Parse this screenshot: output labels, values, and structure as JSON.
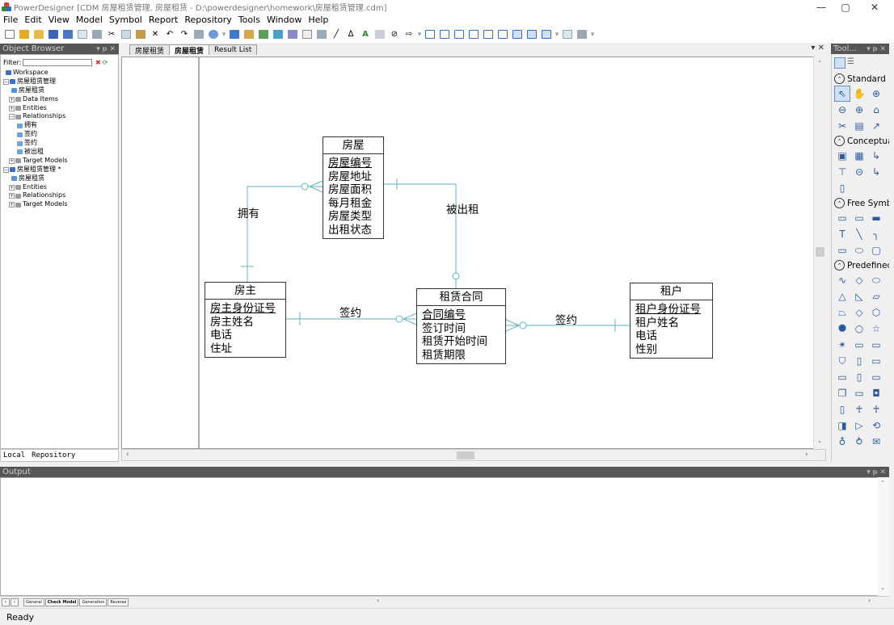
{
  "window": {
    "title": "PowerDesigner [CDM 房屋租赁管理, 房屋租赁 - D:\\powerdesigner\\homework\\房屋租赁管理.cdm]",
    "minimize": "—",
    "restore": "▢",
    "close": "✕"
  },
  "menu": [
    "File",
    "Edit",
    "View",
    "Model",
    "Symbol",
    "Report",
    "Repository",
    "Tools",
    "Window",
    "Help"
  ],
  "object_browser": {
    "title": "Object Browser",
    "controls": "▾ ᵽ ✕",
    "filter_label": "Filter:",
    "filter_value": "",
    "tree": [
      {
        "label": "Workspace",
        "level": 0,
        "expander": "",
        "icon_color": "#3a6fc4"
      },
      {
        "label": "房屋租赁管理",
        "level": 0,
        "expander": "−",
        "icon_color": "#3a6fc4"
      },
      {
        "label": "房屋租赁",
        "level": 1,
        "expander": "",
        "icon_color": "#5b8fd8"
      },
      {
        "label": "Data Items",
        "level": 1,
        "expander": "+",
        "icon_color": "#9a9a9a"
      },
      {
        "label": "Entities",
        "level": 1,
        "expander": "+",
        "icon_color": "#9a9a9a"
      },
      {
        "label": "Relationships",
        "level": 1,
        "expander": "−",
        "icon_color": "#9a9a9a"
      },
      {
        "label": "拥有",
        "level": 2,
        "expander": "",
        "icon_color": "#6aa4d8"
      },
      {
        "label": "签约",
        "level": 2,
        "expander": "",
        "icon_color": "#6aa4d8"
      },
      {
        "label": "签约",
        "level": 2,
        "expander": "",
        "icon_color": "#6aa4d8"
      },
      {
        "label": "被出租",
        "level": 2,
        "expander": "",
        "icon_color": "#6aa4d8"
      },
      {
        "label": "Target Models",
        "level": 1,
        "expander": "+",
        "icon_color": "#9a9a9a"
      },
      {
        "label": "房屋租赁管理 *",
        "level": 0,
        "expander": "−",
        "icon_color": "#3a6fc4"
      },
      {
        "label": "房屋租赁",
        "level": 1,
        "expander": "",
        "icon_color": "#5b8fd8"
      },
      {
        "label": "Entities",
        "level": 1,
        "expander": "+",
        "icon_color": "#9a9a9a"
      },
      {
        "label": "Relationships",
        "level": 1,
        "expander": "+",
        "icon_color": "#9a9a9a"
      },
      {
        "label": "Target Models",
        "level": 1,
        "expander": "+",
        "icon_color": "#9a9a9a"
      }
    ],
    "tabs": [
      "Local",
      "Repository"
    ]
  },
  "doc_tabs": [
    {
      "label": "房屋租赁",
      "active": false
    },
    {
      "label": "房屋租赁",
      "active": true
    },
    {
      "label": "Result List",
      "active": false
    }
  ],
  "doc_tab_controls": "▾ ✕",
  "diagram": {
    "entities": {
      "house": {
        "name": "房屋",
        "attributes": [
          {
            "name": "房屋编号",
            "pk": true
          },
          {
            "name": "房屋地址",
            "pk": false
          },
          {
            "name": "房屋面积",
            "pk": false
          },
          {
            "name": "每月租金",
            "pk": false
          },
          {
            "name": "房屋类型",
            "pk": false
          },
          {
            "name": "出租状态",
            "pk": false
          }
        ]
      },
      "landlord": {
        "name": "房主",
        "attributes": [
          {
            "name": "房主身份证号",
            "pk": true
          },
          {
            "name": "房主姓名",
            "pk": false
          },
          {
            "name": "电话",
            "pk": false
          },
          {
            "name": "住址",
            "pk": false
          }
        ]
      },
      "contract": {
        "name": "租赁合同",
        "attributes": [
          {
            "name": "合同编号",
            "pk": true
          },
          {
            "name": "签订时间",
            "pk": false
          },
          {
            "name": "租赁开始时间",
            "pk": false
          },
          {
            "name": "租赁期限",
            "pk": false
          }
        ]
      },
      "tenant": {
        "name": "租户",
        "attributes": [
          {
            "name": "租户身份证号",
            "pk": true
          },
          {
            "name": "租户姓名",
            "pk": false
          },
          {
            "name": "电话",
            "pk": false
          },
          {
            "name": "性别",
            "pk": false
          }
        ]
      }
    },
    "relationships": {
      "own": "拥有",
      "rented": "被出租",
      "sign1": "签约",
      "sign2": "签约"
    },
    "line_color": "#5fb5c5"
  },
  "toolbox": {
    "title": "Tool...",
    "controls": "▾ ᵽ ✕",
    "groups": [
      {
        "name": "Standard",
        "tools": [
          "pointer-tool",
          "grabber-tool",
          "zoom-in-tool",
          "zoom-out-tool",
          "open-package-tool",
          "properties-tool",
          "delete-tool",
          "paste-tool",
          "link-tool"
        ]
      },
      {
        "name": "Conceptual",
        "tools": [
          "entity-tool",
          "data-item-tool",
          "relationship-tool",
          "inheritance-tool",
          "association-tool",
          "association-link-tool",
          "file-tool"
        ]
      },
      {
        "name": "Free Symbols",
        "tools": [
          "note-tool",
          "text-tool",
          "line-tool",
          "arc-tool",
          "rectangle-tool",
          "ellipse-tool",
          "rounded-rect-tool",
          "polyline-tool",
          "polygon-tool"
        ]
      },
      {
        "name": "Predefined",
        "tools": [
          "pill-shape",
          "triangle-shape",
          "right-triangle-shape",
          "parallelogram-shape",
          "trapezoid-shape",
          "diamond-shape",
          "hexagon-shape",
          "octagon-shape",
          "circle-shape",
          "star-shape",
          "burst-shape",
          "banner-shape",
          "plate-shape",
          "shield-shape",
          "scroll-shape",
          "process-shape",
          "tab-shape",
          "document-shape",
          "card-shape",
          "cube-shape",
          "frame-shape",
          "box-shape",
          "cylinder-shape",
          "actor-shape",
          "actor2-shape",
          "folder-shape",
          "arrow-shape",
          "display-shape",
          "callout-shape",
          "recycle-shape",
          "letter-shape",
          "window-shape",
          "screen-shape"
        ]
      }
    ],
    "tool_glyphs": [
      "⇖",
      "✋",
      "⊕",
      "⊖",
      "⊕",
      "⌂",
      "✂",
      "▤",
      "↗",
      "▣",
      "▦",
      "↳",
      "⊤",
      "⊝",
      "↳",
      "▯",
      "",
      "",
      "▬",
      "T",
      "╲",
      "╮",
      "▭",
      "⬭",
      "▢",
      "∿",
      "◇",
      "⬭",
      "△",
      "◺",
      "▱",
      "⏢",
      "◇",
      "⬡",
      "⯃",
      "○",
      "☆",
      "✴",
      "▭",
      "▭",
      "⛉",
      "▯",
      "▭",
      "▭",
      "▯",
      "▭",
      "❐",
      "▭",
      "◘",
      "▯",
      "♰",
      "♰",
      "◨",
      "▷",
      "⟲",
      "♁",
      "⥁",
      "✉",
      "▭",
      "▭"
    ]
  },
  "output": {
    "title": "Output",
    "controls": "▾ ᵽ ✕",
    "tabs": [
      {
        "label": "General",
        "active": false
      },
      {
        "label": "Check Model",
        "active": true
      },
      {
        "label": "Generation",
        "active": false
      },
      {
        "label": "Reverse",
        "active": false
      }
    ]
  },
  "status": "Ready"
}
